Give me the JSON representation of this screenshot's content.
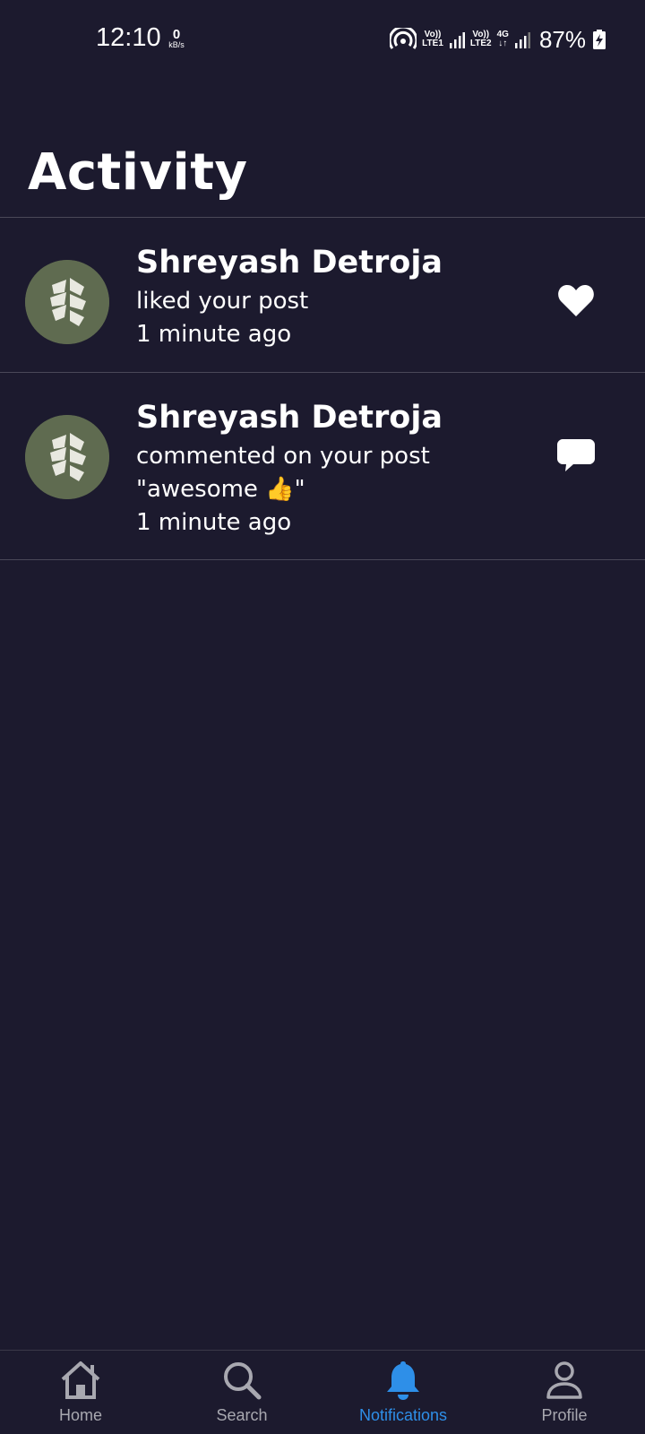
{
  "status_bar": {
    "time": "12:10",
    "speed_value": "0",
    "speed_unit": "kB/s",
    "sim1_label_top": "Vo))",
    "sim1_label_bottom": "LTE1",
    "sim2_label_top": "Vo))",
    "sim2_label_bottom": "LTE2",
    "network_type": "4G",
    "battery": "87%"
  },
  "page": {
    "title": "Activity"
  },
  "activities": [
    {
      "name": "Shreyash Detroja",
      "action": "liked your post",
      "comment": "",
      "time": "1 minute ago",
      "icon": "heart-icon"
    },
    {
      "name": "Shreyash Detroja",
      "action": "commented on your post",
      "comment": "\"awesome 👍\"",
      "time": "1 minute ago",
      "icon": "comment-icon"
    }
  ],
  "bottom_nav": {
    "items": [
      {
        "label": "Home",
        "icon": "home-icon",
        "active": false
      },
      {
        "label": "Search",
        "icon": "search-icon",
        "active": false
      },
      {
        "label": "Notifications",
        "icon": "bell-icon",
        "active": true
      },
      {
        "label": "Profile",
        "icon": "profile-icon",
        "active": false
      }
    ]
  },
  "colors": {
    "background": "#1c1a2e",
    "accent": "#2e8fe8",
    "inactive": "#a8a8b0",
    "avatar_bg": "#5f6b50"
  }
}
